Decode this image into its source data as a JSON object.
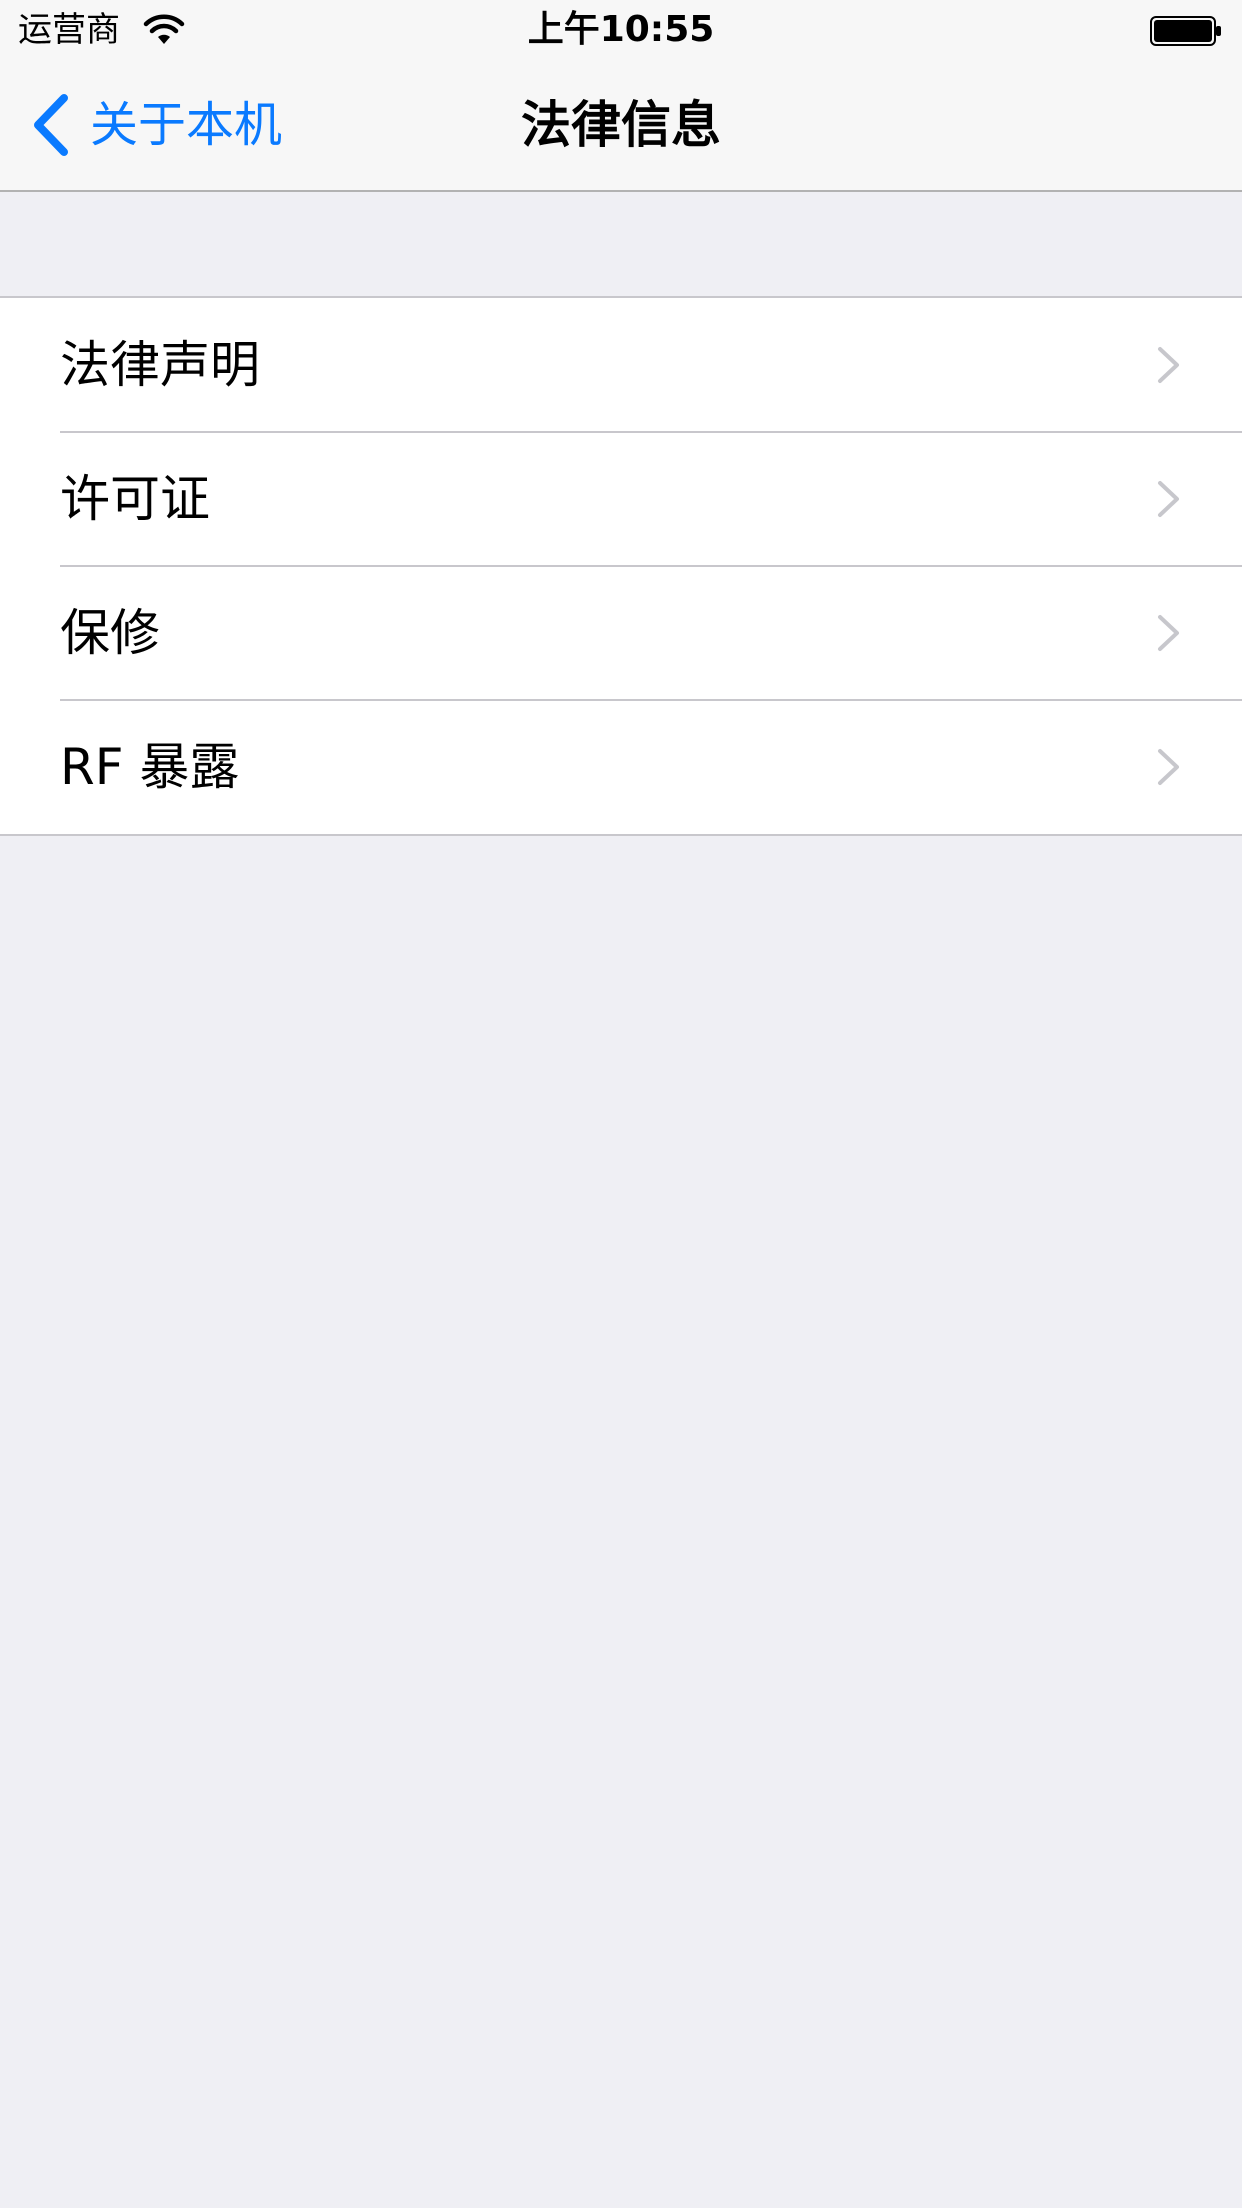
{
  "status_bar": {
    "carrier": "运营商",
    "time": "上午10:55"
  },
  "nav": {
    "back_label": "关于本机",
    "title": "法律信息"
  },
  "list": {
    "items": [
      {
        "label": "法律声明"
      },
      {
        "label": "许可证"
      },
      {
        "label": "保修"
      },
      {
        "label": "RF 暴露"
      }
    ]
  },
  "colors": {
    "accent": "#0a7aff",
    "background": "#efeff4",
    "separator": "#c8c7cc",
    "chevron": "#c7c7cc"
  },
  "icons": [
    "wifi-icon",
    "battery-icon",
    "back-chevron-icon",
    "chevron-right-icon"
  ]
}
